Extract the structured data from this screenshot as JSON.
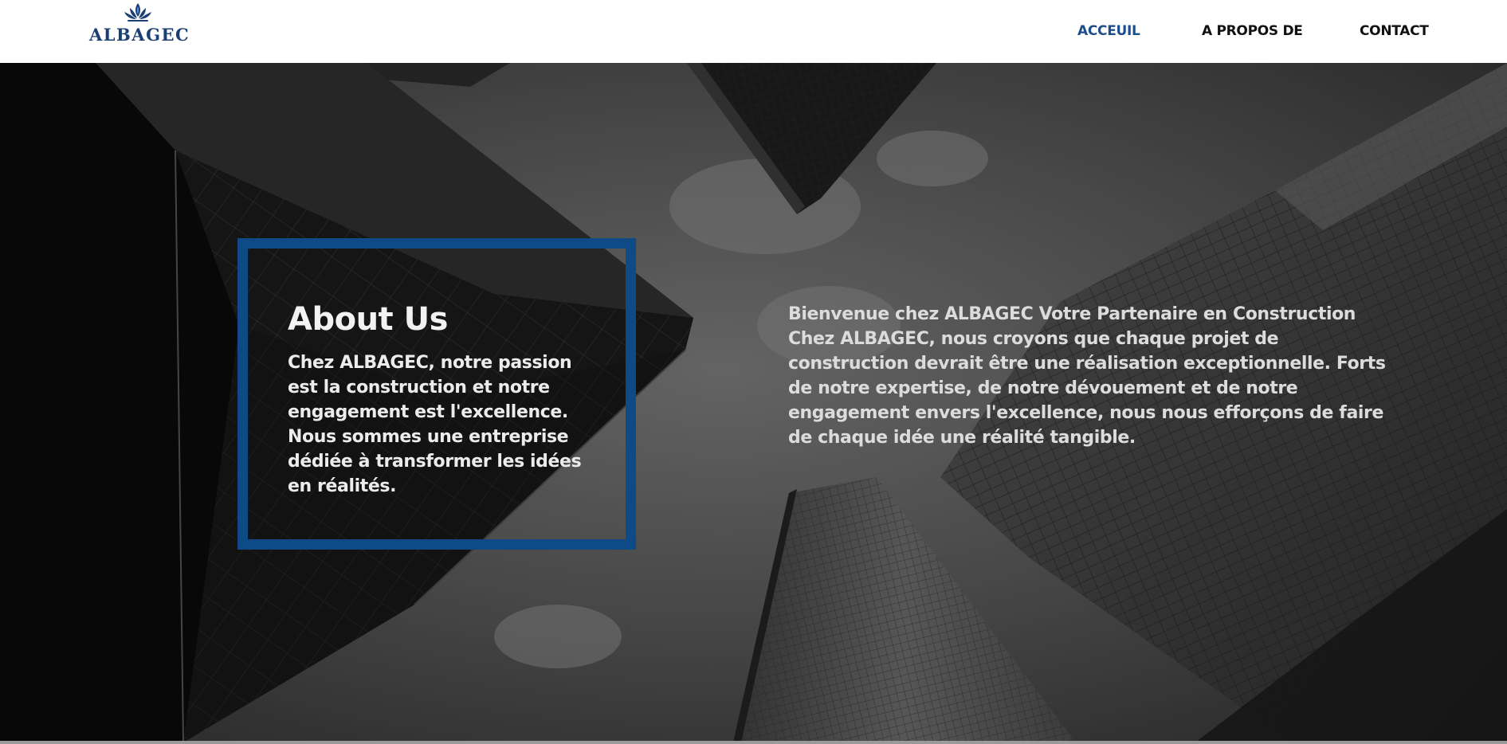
{
  "brand": {
    "name": "ALBAGEC",
    "logo_icon": "lotus-icon",
    "primary_color": "#1b3f73",
    "accent_color": "#0e4a86"
  },
  "nav": {
    "items": [
      {
        "label": "ACCEUIL",
        "active": true
      },
      {
        "label": "A PROPOS DE",
        "active": false
      },
      {
        "label": "CONTACT",
        "active": false
      }
    ],
    "active_color": "#1d4e8c"
  },
  "hero": {
    "background": "grayscale skyscrapers photo, looking up",
    "about_title": "About Us",
    "about_text": "Chez ALBAGEC, notre passion est la construction et notre engagement est l'excellence. Nous sommes une entreprise dédiée à transformer les idées en réalités.",
    "intro_text": "Bienvenue chez ALBAGEC Votre Partenaire en Construction Chez ALBAGEC, nous croyons que chaque projet de construction devrait être une réalisation exceptionnelle. Forts de notre expertise, de notre dévouement et de notre engagement envers l'excellence, nous nous efforçons de faire de chaque idée une réalité tangible."
  }
}
